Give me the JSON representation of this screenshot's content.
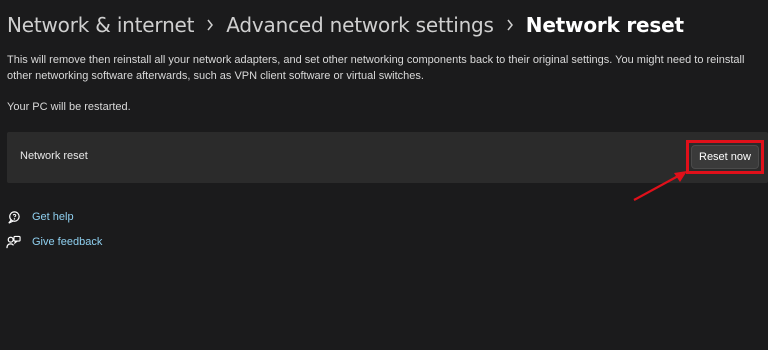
{
  "breadcrumb": {
    "items": [
      "Network & internet",
      "Advanced network settings"
    ],
    "current": "Network reset"
  },
  "description": "This will remove then reinstall all your network adapters, and set other networking components back to their original settings. You might need to reinstall other networking software afterwards, such as VPN client software or virtual switches.",
  "restart_note": "Your PC will be restarted.",
  "reset_card": {
    "label": "Network reset",
    "button_label": "Reset now"
  },
  "links": {
    "help": "Get help",
    "feedback": "Give feedback"
  },
  "icons": {
    "separator": "chevron-right-icon",
    "help": "help-chat-icon",
    "feedback": "feedback-icon"
  },
  "colors": {
    "background": "#1b1b1c",
    "card": "#2b2b2b",
    "link": "#8fd0f0",
    "annotation": "#e0101a"
  }
}
